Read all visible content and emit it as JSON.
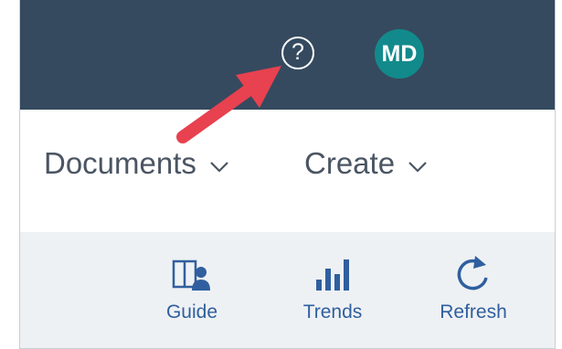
{
  "header": {
    "help_glyph": "?",
    "help_icon": "question-circle-icon",
    "avatar_initials": "MD",
    "background_color": "#354a5f",
    "avatar_color": "#128a8c"
  },
  "menu": {
    "items": [
      {
        "label": "Documents",
        "icon": "chevron-down-icon"
      },
      {
        "label": "Create",
        "icon": "chevron-down-icon"
      }
    ]
  },
  "toolbar": {
    "items": [
      {
        "label": "Guide",
        "icon": "guide-icon"
      },
      {
        "label": "Trends",
        "icon": "bar-chart-icon"
      },
      {
        "label": "Refresh",
        "icon": "refresh-icon"
      }
    ],
    "accent_color": "#2f5f9e"
  },
  "annotation": {
    "arrow_color": "#e8414f",
    "target": "help-button"
  }
}
